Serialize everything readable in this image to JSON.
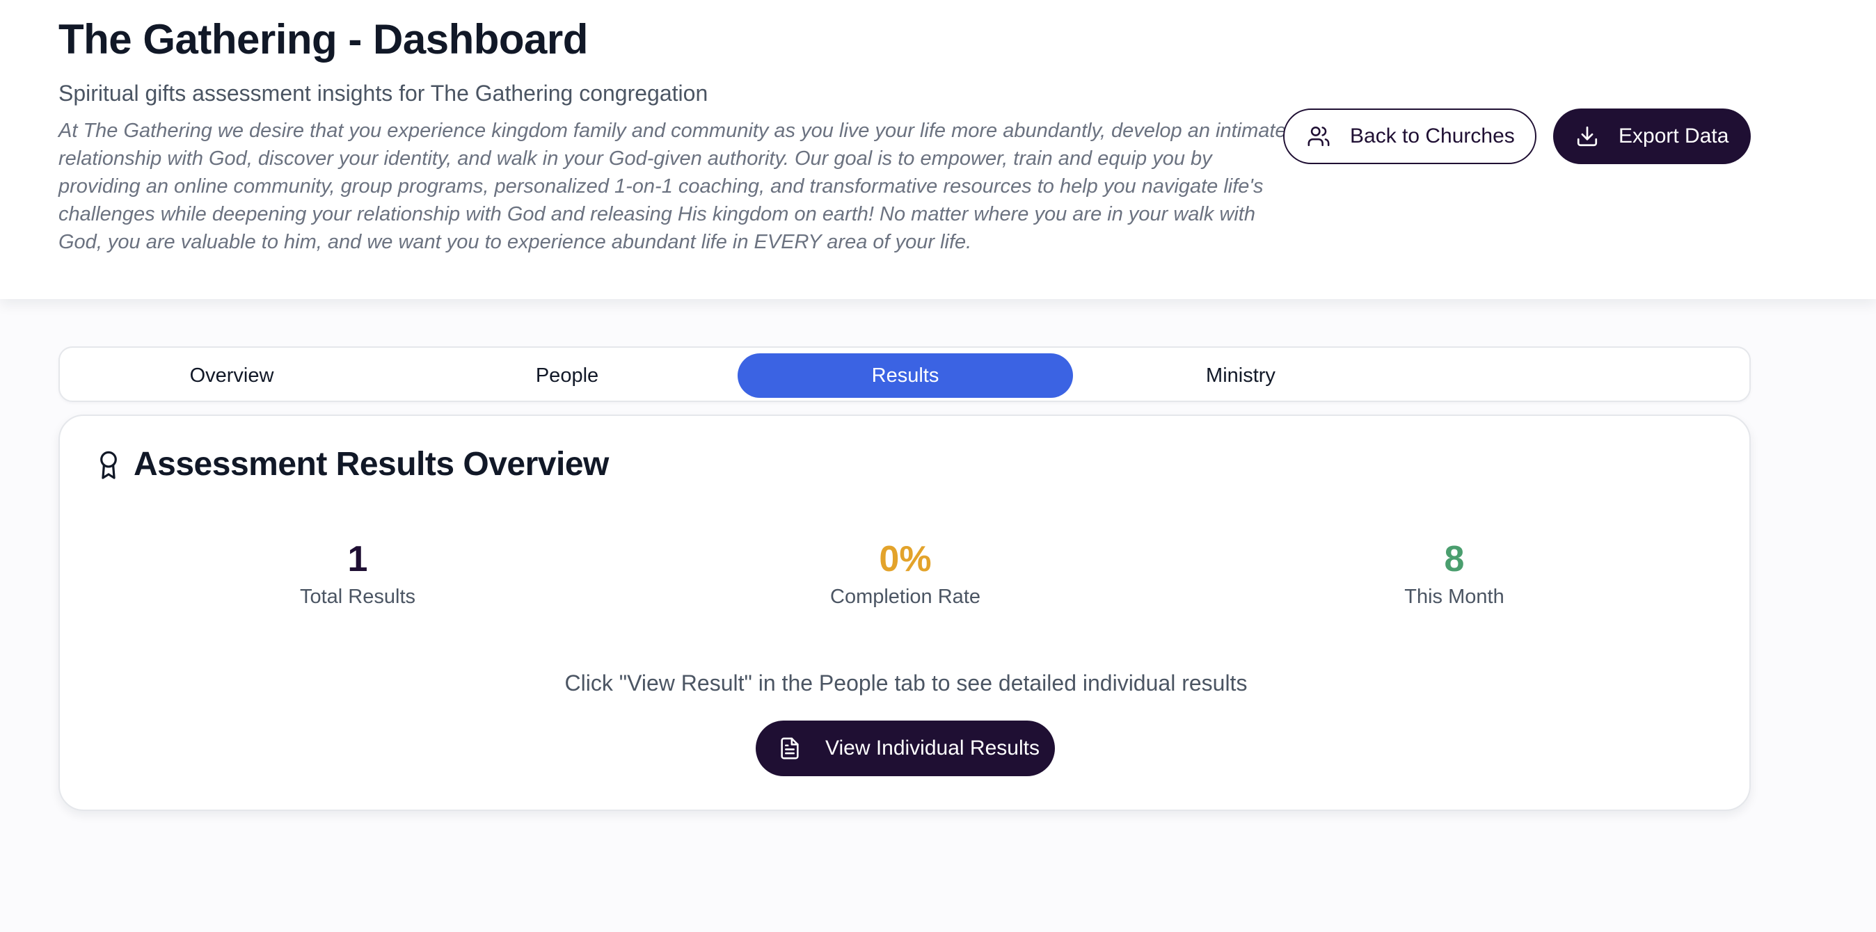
{
  "header": {
    "title": "The Gathering - Dashboard",
    "subtitle": "Spiritual gifts assessment insights for The Gathering congregation",
    "description": "At The Gathering we desire that you experience kingdom family and community as you live your life more abundantly, develop an intimate relationship with God, discover your identity, and walk in your God-given authority. Our goal is to empower, train and equip you by providing an online community, group programs, personalized 1-on-1 coaching, and transformative resources to help you navigate life's challenges while deepening your relationship with God and releasing His kingdom on earth! No matter where you are in your walk with God, you are valuable to him, and we want you to experience abundant life in EVERY area of your life.",
    "back_label": "Back to Churches",
    "back_icon": "users-icon",
    "export_label": "Export Data",
    "export_icon": "download-icon"
  },
  "tabs": [
    {
      "label": "Overview",
      "active": false
    },
    {
      "label": "People",
      "active": false
    },
    {
      "label": "Results",
      "active": true
    },
    {
      "label": "Ministry",
      "active": false
    }
  ],
  "results": {
    "title": "Assessment Results Overview",
    "title_icon": "award-icon",
    "stats": [
      {
        "value": "1",
        "label": "Total Results",
        "color": "#1f0f33"
      },
      {
        "value": "0%",
        "label": "Completion Rate",
        "color": "#e3a32b"
      },
      {
        "value": "8",
        "label": "This Month",
        "color": "#4a9e6e"
      }
    ],
    "hint": "Click \"View Result\" in the People tab to see detailed individual results",
    "view_label": "View Individual Results",
    "view_icon": "file-text-icon"
  },
  "colors": {
    "primary": "#1f0f33",
    "accent_blue": "#3b63e3"
  }
}
